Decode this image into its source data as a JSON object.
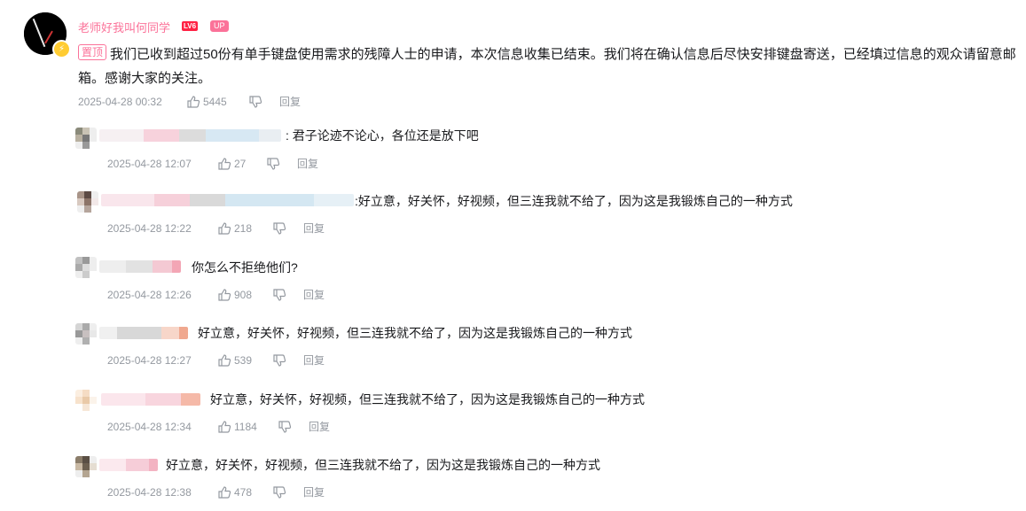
{
  "root": {
    "username": "老师好我叫何同学",
    "level": "LV6",
    "up_tag": "UP",
    "pinned_tag": "置顶",
    "content": "我们已收到超过50份有单手键盘使用需求的残障人士的申请，本次信息收集已结束。我们将在确认信息后尽快安排键盘寄送，已经填过信息的观众请留意邮箱。感谢大家的关注。",
    "time": "2025-04-28 00:32",
    "likes": "5445",
    "reply_label": "回复"
  },
  "replies": [
    {
      "text": ": 君子论迹不论心，各位还是放下吧",
      "time": "2025-04-28 12:07",
      "likes": "27",
      "reply_label": "回复"
    },
    {
      "text": ":好立意，好关怀，好视频，但三连我就不给了，因为这是我锻炼自己的一种方式",
      "time": "2025-04-28 12:22",
      "likes": "218",
      "reply_label": "回复"
    },
    {
      "text": "你怎么不拒绝他们?",
      "time": "2025-04-28 12:26",
      "likes": "908",
      "reply_label": "回复"
    },
    {
      "text": "好立意，好关怀，好视频，但三连我就不给了，因为这是我锻炼自己的一种方式",
      "time": "2025-04-28 12:27",
      "likes": "539",
      "reply_label": "回复"
    },
    {
      "text": "好立意，好关怀，好视频，但三连我就不给了，因为这是我锻炼自己的一种方式",
      "time": "2025-04-28 12:34",
      "likes": "1184",
      "reply_label": "回复"
    },
    {
      "text": "好立意，好关怀，好视频，但三连我就不给了，因为这是我锻炼自己的一种方式",
      "time": "2025-04-28 12:38",
      "likes": "478",
      "reply_label": "回复"
    }
  ],
  "colors": {
    "accent_pink": "#fb7299",
    "meta_gray": "#9499a0",
    "text": "#18191c",
    "badge_yellow": "#ffcc33"
  },
  "icons": [
    "thumb-up-icon",
    "thumb-down-icon",
    "lightning-badge-icon"
  ]
}
